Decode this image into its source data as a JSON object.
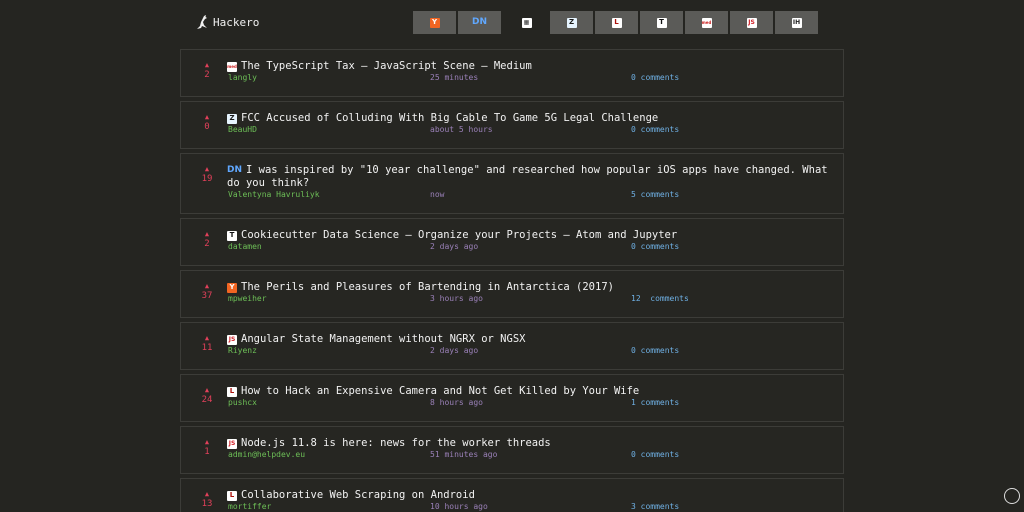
{
  "app": {
    "name": "Hackero"
  },
  "tabs": [
    {
      "id": "hackernews",
      "icon": "ycombinator-icon",
      "glyph": "Y"
    },
    {
      "id": "designernews",
      "icon": "designernews-icon",
      "glyph": "DN"
    },
    {
      "id": "producthunt",
      "icon": "producthunt-icon",
      "glyph": "▦",
      "active": true
    },
    {
      "id": "zeroes",
      "icon": "zr-icon",
      "glyph": "Z"
    },
    {
      "id": "lobsters",
      "icon": "lobsters-icon",
      "glyph": "L"
    },
    {
      "id": "techbeacon",
      "icon": "t-icon",
      "glyph": "T"
    },
    {
      "id": "medium",
      "icon": "medium-icon",
      "glyph": "med"
    },
    {
      "id": "echojs",
      "icon": "js-icon",
      "glyph": "JS"
    },
    {
      "id": "indiehackers",
      "icon": "ih-icon",
      "glyph": "IH"
    }
  ],
  "posts": [
    {
      "score": "2",
      "src": "md",
      "srcIcon": "medium-icon",
      "glyph": "med",
      "title": "The TypeScript Tax – JavaScript Scene – Medium",
      "author": "langly",
      "time": "25 minutes",
      "comments": "0 comments"
    },
    {
      "score": "0",
      "src": "zr",
      "srcIcon": "zr-icon",
      "glyph": "Z",
      "title": "FCC Accused of Colluding With Big Cable To Game 5G Legal Challenge",
      "author": "BeauHD",
      "time": "about 5 hours",
      "comments": "0 comments"
    },
    {
      "score": "19",
      "src": "dn",
      "srcIcon": "designernews-icon",
      "glyph": "DN",
      "title": "I was inspired by \"10 year challenge\" and researched how popular iOS apps have changed. What do you think?",
      "author": "Valentyna Havruliyk",
      "time": "now",
      "comments": "5 comments",
      "tall": true
    },
    {
      "score": "2",
      "src": "tb",
      "srcIcon": "t-icon",
      "glyph": "T",
      "title": "Cookiecutter Data Science – Organize your Projects – Atom and Jupyter",
      "author": "datamen",
      "time": "2 days ago",
      "comments": "0 comments"
    },
    {
      "score": "37",
      "src": "yc",
      "srcIcon": "ycombinator-icon",
      "glyph": "Y",
      "title": "The Perils and Pleasures of Bartending in Antarctica (2017)",
      "author": "mpweiher",
      "time": "3 hours ago",
      "comments": "12  comments"
    },
    {
      "score": "11",
      "src": "js",
      "srcIcon": "js-icon",
      "glyph": "JS",
      "title": "Angular State Management without NGRX or NGSX",
      "author": "Riyenz",
      "time": "2 days ago",
      "comments": "0 comments"
    },
    {
      "score": "24",
      "src": "lb",
      "srcIcon": "lobsters-icon",
      "glyph": "L",
      "title": "How to Hack an Expensive Camera and Not Get Killed by Your Wife",
      "author": "pushcx",
      "time": "8 hours ago",
      "comments": "1 comments"
    },
    {
      "score": "1",
      "src": "js",
      "srcIcon": "js-icon",
      "glyph": "JS",
      "title": "Node.js 11.8 is here: news for the worker threads",
      "author": "admin@helpdev.eu",
      "time": "51 minutes ago",
      "comments": "0 comments"
    },
    {
      "score": "13",
      "src": "lb",
      "srcIcon": "lobsters-icon",
      "glyph": "L",
      "title": "Collaborative Web Scraping on Android",
      "author": "mortiffer",
      "time": "10 hours ago",
      "comments": "3 comments"
    }
  ]
}
